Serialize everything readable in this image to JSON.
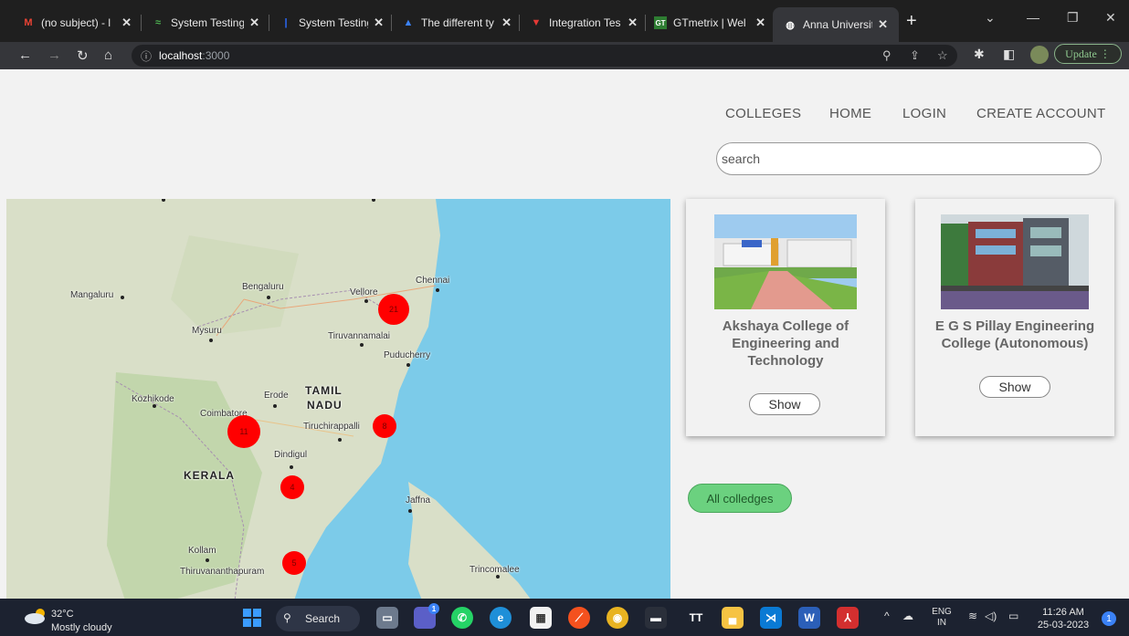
{
  "browser": {
    "tabs": [
      {
        "title": "(no subject) - l",
        "icon": "gmail-icon"
      },
      {
        "title": "System Testing",
        "icon": "tab-site-icon"
      },
      {
        "title": "System Testing",
        "icon": "tab-site-icon"
      },
      {
        "title": "The different ty",
        "icon": "tab-site-icon"
      },
      {
        "title": "Integration Tes",
        "icon": "tab-site-icon"
      },
      {
        "title": "GTmetrix | Wel",
        "icon": "gtmetrix-icon"
      },
      {
        "title": "Anna Universit",
        "icon": "globe-icon"
      }
    ],
    "gtmetrix_favicon_text": "GT",
    "url_host": "localhost",
    "url_port": ":3000",
    "update_label": "Update",
    "new_tab_glyph": "+"
  },
  "nav": {
    "colleges": "COLLEGES",
    "home": "HOME",
    "login": "LOGIN",
    "create_account": "CREATE ACCOUNT"
  },
  "search": {
    "placeholder": "search"
  },
  "map": {
    "labels": {
      "chennai": "Chennai",
      "mangaluru": "Mangaluru",
      "bengaluru": "Bengaluru",
      "vellore": "Vellore",
      "mysuru": "Mysuru",
      "tiruvannamalai": "Tiruvannamalai",
      "puducherry": "Puducherry",
      "kozhikode": "Kozhikode",
      "erode": "Erode",
      "tamil": "TAMIL",
      "nadu": "NADU",
      "coimbatore": "Coimbatore",
      "tiruchirappalli": "Tiruchirappalli",
      "dindigul": "Dindigul",
      "kerala": "KERALA",
      "jaffna": "Jaffna",
      "kollam": "Kollam",
      "thiruvananthapuram": "Thiruvananthapuram",
      "trincomalee": "Trincomalee"
    },
    "clusters": {
      "chennai_region": "21",
      "coimbatore_region": "11",
      "trichy_region": "8",
      "madurai_region": "4",
      "south_region": "5"
    }
  },
  "colleges": [
    {
      "name": "Akshaya College of Engineering and Technology",
      "button": "Show"
    },
    {
      "name": "E G S Pillay Engineering College (Autonomous)",
      "button": "Show"
    }
  ],
  "all_colleges_button": "All colledges",
  "taskbar": {
    "temperature": "32°C",
    "weather": "Mostly cloudy",
    "search_label": "Search",
    "lang": "ENG",
    "region": "IN",
    "time": "11:26 AM",
    "date": "25-03-2023",
    "chat_badge": "1",
    "vscode_label": "TT",
    "word_label": "W",
    "notification_count": "1"
  },
  "colors": {
    "map_water": "#7ccbe9",
    "cluster_red": "#ff0000",
    "all_button_green": "#6bd17f"
  }
}
